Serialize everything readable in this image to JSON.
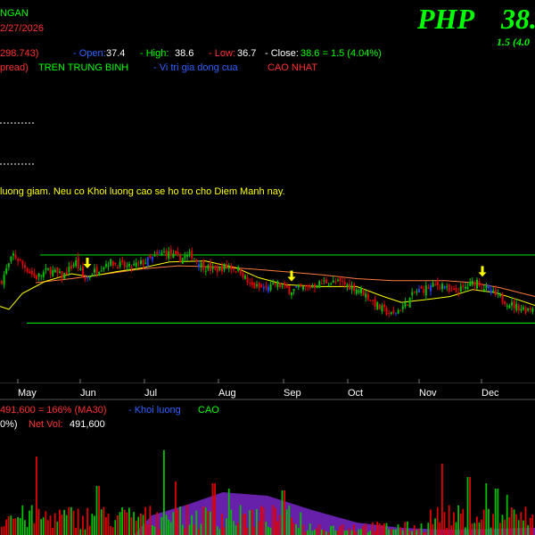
{
  "header": {
    "name_fragment": "NGAN",
    "date_fragment": "2/27/2026",
    "symbol": "PHP",
    "price": "38.",
    "change_fragment": "1.5 (4.0",
    "ohlc": {
      "prefix": "298.743)",
      "open_label": "- Open:",
      "open": "37.4",
      "high_label": "- High:",
      "high": "38.6",
      "low_label": "- Low:",
      "low": "36.7",
      "close_label": "- Close:",
      "close_text": "38.6 = 1.5 (4.04%)"
    },
    "legend": {
      "item1": "pread)",
      "item2": "TREN TRUNG BINH",
      "item3": "- Vi tri gia dong cua",
      "item4": "CAO NHAT"
    },
    "note": "luong giam. Neu co Khoi luong cao se ho tro cho Diem Manh nay."
  },
  "volume_header": {
    "line1_value": "491,600 = 166% (MA30)",
    "line1_label": "- Khoi luong",
    "line1_suffix": "CAO",
    "line2_pct": "0%)",
    "line2_label": "Net Vol:",
    "line2_value": "491,600"
  },
  "colors": {
    "background": "#000000",
    "up": "#00c000",
    "down": "#e00000",
    "highlight": "#2040ff",
    "ma_fast": "#ffff00",
    "ma_slow": "#ff7a40",
    "channel": "#00cc00",
    "title_green": "#00ff00",
    "signal_arrow": "#ffff00",
    "volume_ma": "#8a2be2"
  },
  "chart_data": {
    "type": "candlestick",
    "x_tick_labels": [
      "May",
      "Jun",
      "Jul",
      "Aug",
      "Sep",
      "Oct",
      "Nov",
      "Dec"
    ],
    "price_range": [
      28.5,
      47.0
    ],
    "channel": {
      "upper": 41.5,
      "lower": 34.6
    },
    "volume_range": [
      0,
      1000000
    ],
    "price_control_points": [
      [
        0,
        38.6
      ],
      [
        15,
        41.5
      ],
      [
        40,
        39.2
      ],
      [
        55,
        40.0
      ],
      [
        70,
        39.3
      ],
      [
        85,
        40.8
      ],
      [
        95,
        39.0
      ],
      [
        105,
        39.8
      ],
      [
        122,
        40.8
      ],
      [
        145,
        40.2
      ],
      [
        165,
        40.9
      ],
      [
        185,
        41.8
      ],
      [
        200,
        41.1
      ],
      [
        215,
        41.5
      ],
      [
        225,
        40.5
      ],
      [
        240,
        39.9
      ],
      [
        255,
        40.4
      ],
      [
        270,
        39.9
      ],
      [
        280,
        38.4
      ],
      [
        300,
        38.0
      ],
      [
        310,
        38.6
      ],
      [
        325,
        37.9
      ],
      [
        345,
        38.2
      ],
      [
        365,
        38.8
      ],
      [
        385,
        38.6
      ],
      [
        405,
        37.9
      ],
      [
        425,
        36.2
      ],
      [
        440,
        35.4
      ],
      [
        455,
        36.5
      ],
      [
        465,
        37.7
      ],
      [
        480,
        38.2
      ],
      [
        495,
        38.6
      ],
      [
        505,
        37.6
      ],
      [
        520,
        38.1
      ],
      [
        535,
        38.9
      ],
      [
        548,
        37.8
      ],
      [
        560,
        37.2
      ],
      [
        575,
        36.4
      ],
      [
        590,
        36.0
      ],
      [
        600,
        36.3
      ]
    ],
    "ma_fast_points": [
      [
        0,
        36.3
      ],
      [
        10,
        36.0
      ],
      [
        25,
        37.6
      ],
      [
        50,
        38.8
      ],
      [
        80,
        39.6
      ],
      [
        100,
        39.3
      ],
      [
        130,
        39.8
      ],
      [
        160,
        40.2
      ],
      [
        190,
        40.8
      ],
      [
        230,
        40.9
      ],
      [
        265,
        40.2
      ],
      [
        290,
        39.2
      ],
      [
        320,
        38.5
      ],
      [
        360,
        38.3
      ],
      [
        400,
        38.3
      ],
      [
        430,
        37.3
      ],
      [
        450,
        36.7
      ],
      [
        480,
        37.0
      ],
      [
        505,
        37.3
      ],
      [
        530,
        38.0
      ],
      [
        555,
        37.7
      ],
      [
        580,
        37.0
      ],
      [
        600,
        36.4
      ]
    ],
    "ma_slow_points": [
      [
        40,
        38.7
      ],
      [
        80,
        39.1
      ],
      [
        120,
        39.6
      ],
      [
        160,
        40.1
      ],
      [
        200,
        40.4
      ],
      [
        240,
        40.3
      ],
      [
        280,
        40.1
      ],
      [
        320,
        39.8
      ],
      [
        360,
        39.5
      ],
      [
        400,
        39.1
      ],
      [
        440,
        38.9
      ],
      [
        470,
        38.9
      ],
      [
        500,
        38.9
      ],
      [
        530,
        38.7
      ],
      [
        560,
        38.2
      ],
      [
        600,
        37.3
      ]
    ],
    "signal_arrow_x": [
      98,
      327,
      541
    ]
  }
}
